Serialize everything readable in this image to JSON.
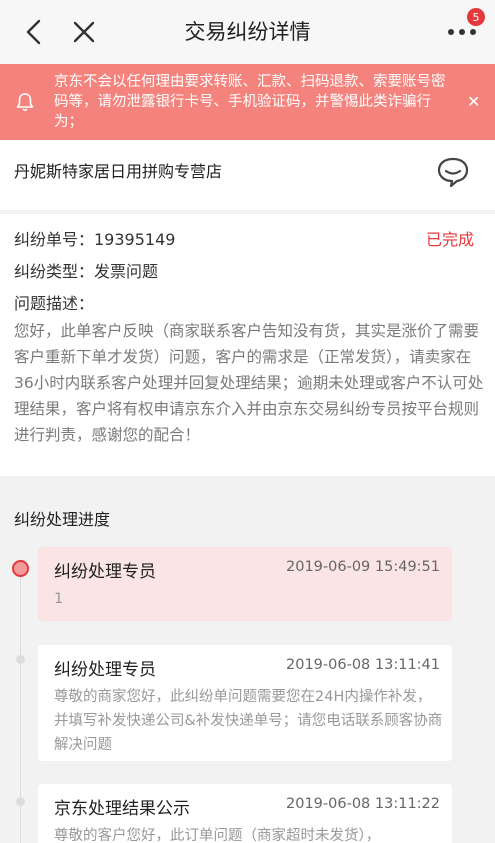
{
  "header": {
    "title": "交易纠纷详情",
    "badge_count": "5"
  },
  "notice": {
    "text": "京东不会以任何理由要求转账、汇款、扫码退款、索要账号密码等，请勿泄露银行卡号、手机验证码，并警惕此类诈骗行为；"
  },
  "shop": {
    "name": "丹妮斯特家居日用拼购专营店"
  },
  "dispute": {
    "number_label": "纠纷单号：19395149",
    "status": "已完成",
    "type_label": "纠纷类型：发票问题",
    "desc_label": "问题描述：",
    "desc_text": "您好，此单客户反映（商家联系客户告知没有货，其实是涨价了需要客户重新下单才发货）问题，客户的需求是（正常发货），请卖家在36小时内联系客户处理并回复处理结果；逾期未处理或客户不认可处理结果，客户将有权申请京东介入并由京东交易纠纷专员按平台规则进行判责，感谢您的配合！"
  },
  "progress": {
    "title": "纠纷处理进度",
    "items": [
      {
        "role": "纠纷处理专员",
        "time": "2019-06-09 15:49:51",
        "body": "1"
      },
      {
        "role": "纠纷处理专员",
        "time": "2019-06-08 13:11:41",
        "body": "尊敬的商家您好，此纠纷单问题需要您在24H内操作补发，并填写补发快递公司&补发快递单号；请您电话联系顾客协商解决问题"
      },
      {
        "role": "京东处理结果公示",
        "time": "2019-06-08 13:11:22",
        "body": "尊敬的客户您好，此订单问题（商家超时未发货），"
      }
    ]
  },
  "colors": {
    "accent": "#e4393c",
    "notice_bg": "#f4827d"
  }
}
